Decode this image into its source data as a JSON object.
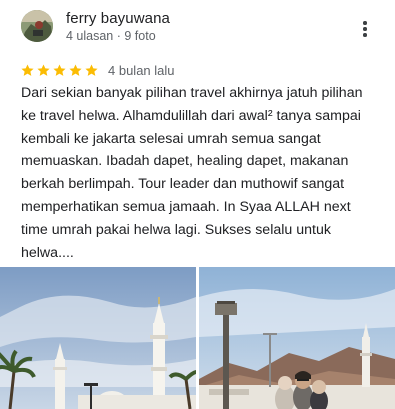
{
  "reviewer": {
    "name": "ferry bayuwana",
    "meta": "4 ulasan · 9 foto"
  },
  "rating": {
    "stars": 5,
    "max_stars": 5,
    "star_color": "#fbbc04",
    "time": "4 bulan lalu"
  },
  "review": {
    "text": "Dari sekian banyak pilihan travel akhirnya jatuh pilihan\nke travel helwa. Alhamdulillah dari awal² tanya sampai\nkembali ke jakarta selesai umrah semua sangat\nmemuaskan. Ibadah dapet, healing dapet, makanan\nberkah berlimpah. Tour leader dan muthowif sangat\nmemperhatikan semua jamaah. In Syaa ALLAH next\ntime umrah pakai helwa lagi. Sukses selalu untuk\nhelwa...."
  },
  "icons": {
    "more": "more-vert-icon",
    "star": "star-icon"
  },
  "photos": [
    {
      "name": "mosque-photo"
    },
    {
      "name": "group-selfie-photo"
    }
  ]
}
